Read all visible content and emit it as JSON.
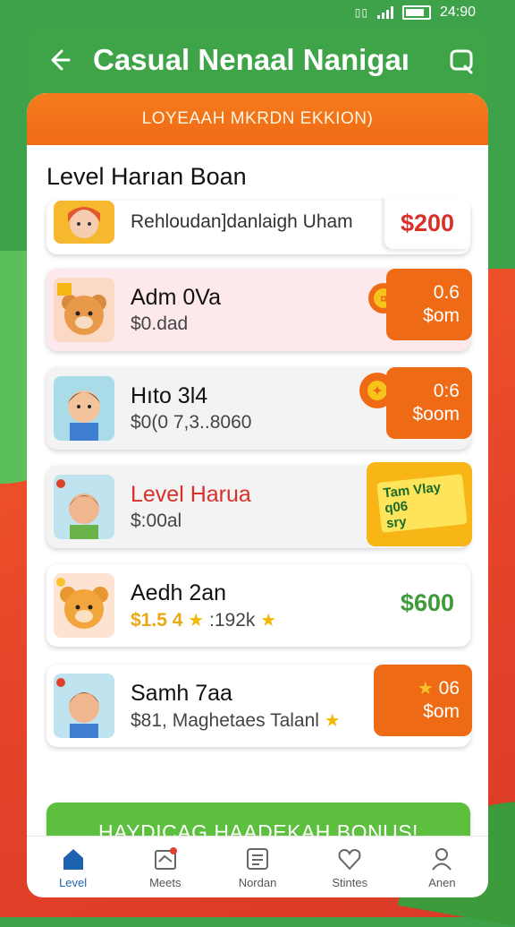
{
  "status_bar": {
    "icons": [
      "alarm-icon",
      "signal-icon",
      "battery-icon"
    ],
    "time": "24:90"
  },
  "header": {
    "back_icon": "arrow-left-icon",
    "title": "Casual Nenaal Nanigaı",
    "action_icon": "search-chat-icon"
  },
  "banner": {
    "text": "LOYEAAH MKRDN EKKION)"
  },
  "section_title": "Level Harıan Boan",
  "rows": [
    {
      "name": "",
      "sub": "Rehloudan]danlaigh Uham",
      "amount": "$200",
      "avatar": "girl-avatar-icon"
    },
    {
      "name": "Adm 0Va",
      "sub": "$0.dad",
      "prize_line1": "0.6",
      "prize_line2": "$om",
      "avatar": "bear-avatar-icon"
    },
    {
      "name": "Hıto 3l4",
      "sub": "$0(0 7,3..8060",
      "prize_line1": "0:6",
      "prize_line2": "$oom",
      "avatar": "boy-avatar-icon"
    },
    {
      "name": "Level Harua",
      "sub": "$:00al",
      "note_line1": "Tam Vlay",
      "note_line2": "q06",
      "note_line3": "sry",
      "avatar": "girl-avatar-icon"
    },
    {
      "name": "Aedh 2an",
      "sub_gold": "$1.5 4",
      "sub_rest": ":192k",
      "amount": "$600",
      "avatar": "bear-avatar-icon"
    },
    {
      "name": "Samh 7aa",
      "sub": "$81, Maghetaes Talanl",
      "prize_line1": "06",
      "prize_line2": "$om",
      "avatar": "boy-avatar-icon"
    }
  ],
  "bonus_button": "HAYDICAG HAADEKAH BONUS!",
  "nav": [
    {
      "label": "Level",
      "icon": "home-icon",
      "active": true
    },
    {
      "label": "Meets",
      "icon": "inbox-icon",
      "active": false
    },
    {
      "label": "Nordan",
      "icon": "list-icon",
      "active": false
    },
    {
      "label": "Stintes",
      "icon": "heart-icon",
      "active": false
    },
    {
      "label": "Anen",
      "icon": "person-icon",
      "active": false
    }
  ],
  "colors": {
    "primary_green": "#3ea447",
    "orange": "#ef6a14",
    "red": "#d9302a",
    "nav_active": "#1d62b0"
  }
}
